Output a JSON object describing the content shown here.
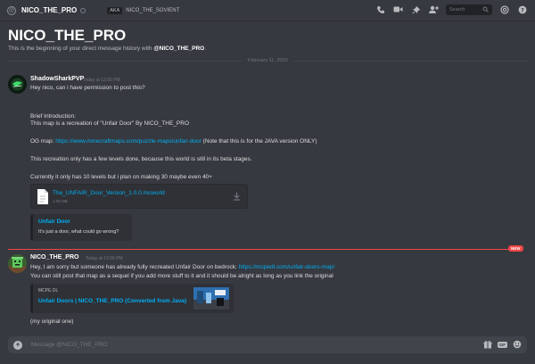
{
  "header": {
    "username": "NICO_THE_PRO",
    "aka_label": "AKA",
    "aka_name": "NICO_THE_SOVIENT",
    "search_placeholder": "Search"
  },
  "intro": {
    "title": "NICO_THE_PRO",
    "text_prefix": "This is the beginning of your direct message history with ",
    "text_name": "@NICO_THE_PRO",
    "text_suffix": "."
  },
  "date_divider": "February 11, 2020",
  "messages": [
    {
      "author": "ShadowSharkPVP",
      "time": "Today at 12:50 PM",
      "lines": [
        "Hey nico, can i have permission to post this?",
        "Brief Introduction:",
        "This map is a recreation of \"Unfair Door\" By NICO_THE_PRO",
        "OG map:",
        "https://www.minecraftmaps.com/puzzle-maps/unfair-door",
        "(Note that this is for the JAVA version ONLY)",
        "This recreation only has a few levels done, because this world is still in its beta stages.",
        "Currently it only has 10 levels but i plan on making 30 maybe even 40+"
      ],
      "attachment": {
        "filename": "The_UNFAIR_Door_Version_1.0.0.mcworld",
        "size": "1.05 MB"
      },
      "embed": {
        "title": "Unfair Door",
        "description": "It's just a door, what could go wrong?"
      }
    },
    {
      "author": "NICO_THE_PRO",
      "time": "Today at 12:56 PM",
      "lines": [
        "Hey, I am sorry but someone has already fully recreated Unfair Door on bedrock:",
        "https://mcpedl.com/unfair-doors-map/",
        "You can still post that map as a sequel if you add more stuff to it and it should be alright as long as you link the original",
        "(my original one)"
      ],
      "embed": {
        "provider": "MCPE DL",
        "title": "Unfair Doors | NICO_THE_PRO (Converted from Java)"
      }
    }
  ],
  "new_badge": "NEW",
  "composer": {
    "placeholder": "Message @NICO_THE_PRO",
    "gif_label": "GIF"
  }
}
